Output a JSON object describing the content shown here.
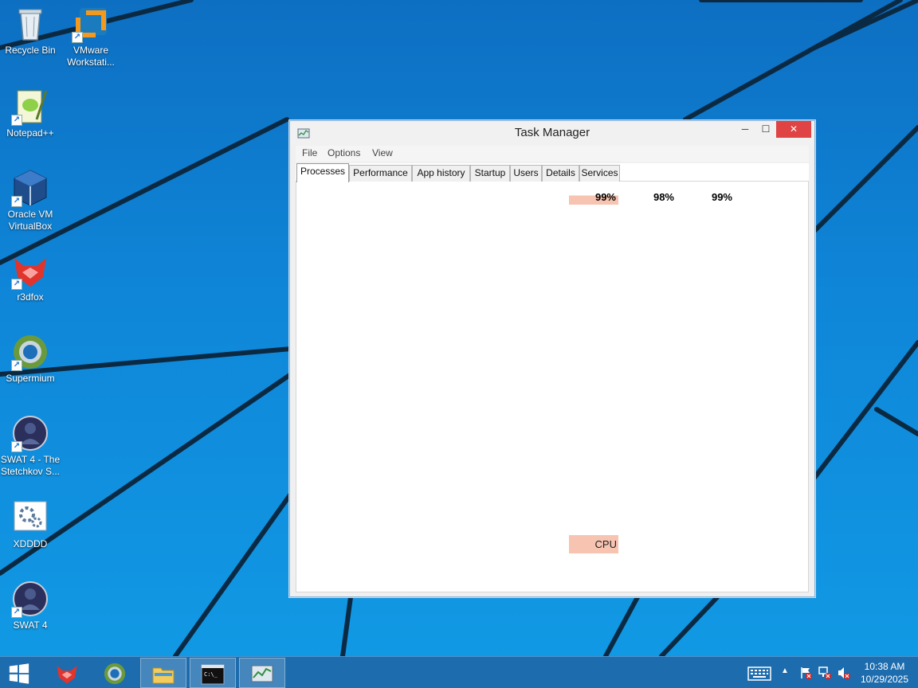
{
  "desktop": {
    "icons": [
      {
        "label": "Recycle Bin",
        "icon": "recycle-bin-icon"
      },
      {
        "label": "VMware Workstati...",
        "icon": "vmware-icon"
      },
      {
        "label": "Notepad++",
        "icon": "notepad-plus-plus-icon"
      },
      {
        "label": "Oracle VM VirtualBox",
        "icon": "virtualbox-icon"
      },
      {
        "label": "r3dfox",
        "icon": "r3dfox-icon"
      },
      {
        "label": "Supermium",
        "icon": "supermium-icon"
      },
      {
        "label": "SWAT 4 - The Stetchkov S...",
        "icon": "swat4-icon"
      },
      {
        "label": "XDDDD",
        "icon": "settings-gears-icon"
      },
      {
        "label": "SWAT 4",
        "icon": "swat4-icon"
      }
    ]
  },
  "task_manager": {
    "title": "Task Manager",
    "menu": [
      "File",
      "Options",
      "View"
    ],
    "tabs": [
      "Processes",
      "Performance",
      "App history",
      "Startup",
      "Users",
      "Details",
      "Services"
    ],
    "active_tab": "Processes",
    "columns": {
      "cpu_percent": "99%",
      "memory_percent": "98%",
      "disk_percent": "99%",
      "cpu_label": "CPU"
    },
    "heat_color": "#f7c4b1"
  },
  "taskbar": {
    "buttons": [
      "start-button",
      "r3dfox-pinned",
      "supermium-pinned",
      "file-explorer-pinned",
      "command-prompt-pinned",
      "task-manager-pinned"
    ],
    "clock_time": "10:38 AM",
    "clock_date": "10/29/2025"
  },
  "colors": {
    "wallpaper": "#0f86d8",
    "taskbar": "#1d6cae",
    "close_button": "#e04343"
  }
}
